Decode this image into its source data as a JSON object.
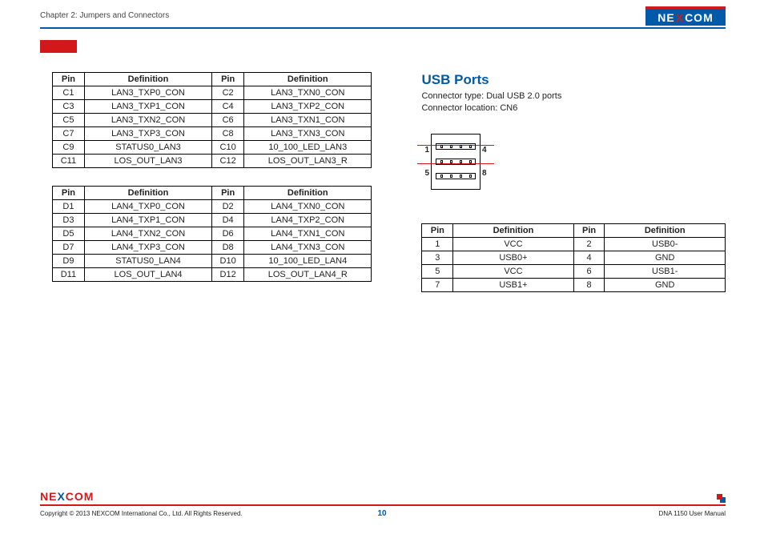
{
  "header": {
    "chapter": "Chapter 2: Jumpers and Connectors",
    "logo_pre": "NE",
    "logo_x": "X",
    "logo_post": "COM"
  },
  "table_c": {
    "headers": [
      "Pin",
      "Definition",
      "Pin",
      "Definition"
    ],
    "rows": [
      [
        "C1",
        "LAN3_TXP0_CON",
        "C2",
        "LAN3_TXN0_CON"
      ],
      [
        "C3",
        "LAN3_TXP1_CON",
        "C4",
        "LAN3_TXP2_CON"
      ],
      [
        "C5",
        "LAN3_TXN2_CON",
        "C6",
        "LAN3_TXN1_CON"
      ],
      [
        "C7",
        "LAN3_TXP3_CON",
        "C8",
        "LAN3_TXN3_CON"
      ],
      [
        "C9",
        "STATUS0_LAN3",
        "C10",
        "10_100_LED_LAN3"
      ],
      [
        "C11",
        "LOS_OUT_LAN3",
        "C12",
        "LOS_OUT_LAN3_R"
      ]
    ]
  },
  "table_d": {
    "headers": [
      "Pin",
      "Definition",
      "Pin",
      "Definition"
    ],
    "rows": [
      [
        "D1",
        "LAN4_TXP0_CON",
        "D2",
        "LAN4_TXN0_CON"
      ],
      [
        "D3",
        "LAN4_TXP1_CON",
        "D4",
        "LAN4_TXP2_CON"
      ],
      [
        "D5",
        "LAN4_TXN2_CON",
        "D6",
        "LAN4_TXN1_CON"
      ],
      [
        "D7",
        "LAN4_TXP3_CON",
        "D8",
        "LAN4_TXN3_CON"
      ],
      [
        "D9",
        "STATUS0_LAN4",
        "D10",
        "10_100_LED_LAN4"
      ],
      [
        "D11",
        "LOS_OUT_LAN4",
        "D12",
        "LOS_OUT_LAN4_R"
      ]
    ]
  },
  "usb": {
    "title": "USB Ports",
    "type_line": "Connector type: Dual USB 2.0 ports",
    "loc_line": "Connector location: CN6",
    "diag": {
      "l1": "1",
      "r1": "4",
      "l2": "5",
      "r2": "8"
    },
    "table": {
      "headers": [
        "Pin",
        "Definition",
        "Pin",
        "Definition"
      ],
      "rows": [
        [
          "1",
          "VCC",
          "2",
          "USB0-"
        ],
        [
          "3",
          "USB0+",
          "4",
          "GND"
        ],
        [
          "5",
          "VCC",
          "6",
          "USB1-"
        ],
        [
          "7",
          "USB1+",
          "8",
          "GND"
        ]
      ]
    }
  },
  "footer": {
    "logo_pre": "NE",
    "logo_x": "X",
    "logo_post": "COM",
    "copyright": "Copyright © 2013 NEXCOM International Co., Ltd. All Rights Reserved.",
    "page": "10",
    "manual": "DNA 1150 User Manual"
  }
}
